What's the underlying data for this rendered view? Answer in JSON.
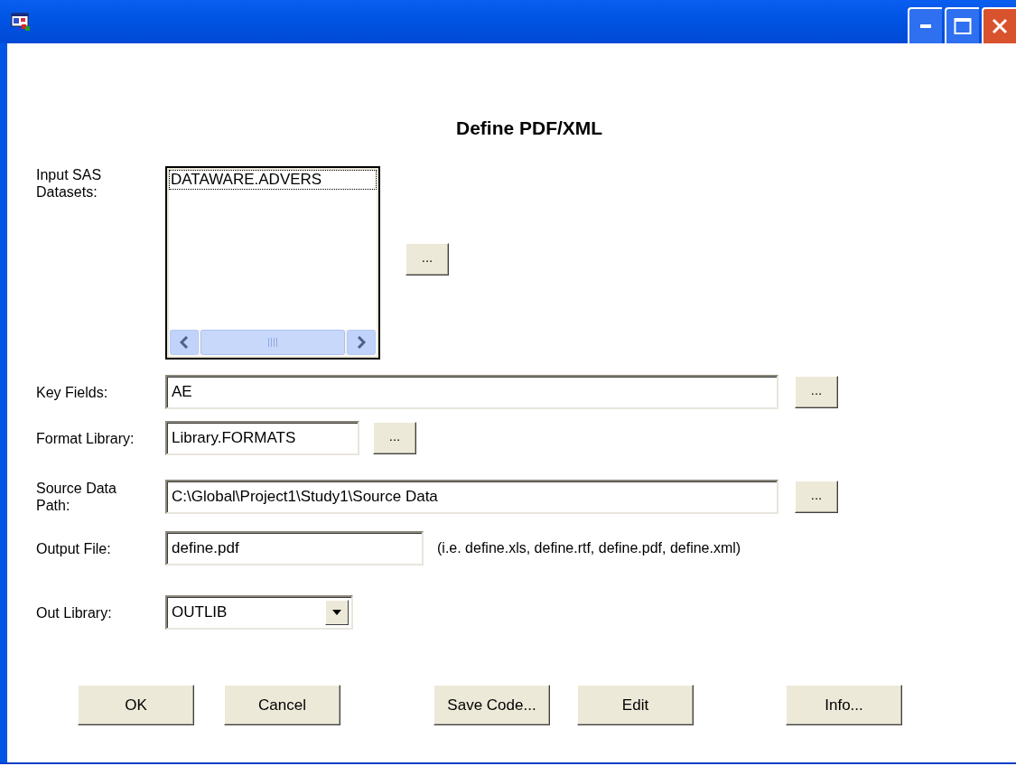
{
  "heading": "Define PDF/XML",
  "fields": [
    {
      "kind": "listbox",
      "label": "Input SAS Datasets:",
      "items": [
        {
          "label": "DATAWARE.ADVERS",
          "focused": true
        }
      ],
      "browse": "..."
    },
    {
      "kind": "text",
      "label": "Key Fields:",
      "value": "AE",
      "browse": "..."
    },
    {
      "kind": "text",
      "label": "Format Library:",
      "value": "Library.FORMATS",
      "browse": "..."
    },
    {
      "kind": "text",
      "label": "Source Data Path:",
      "value": "C:\\Global\\Project1\\Study1\\Source Data",
      "browse": "..."
    },
    {
      "kind": "text",
      "label": "Output File:",
      "value": "define.pdf",
      "hint": "(i.e. define.xls, define.rtf, define.pdf, define.xml)"
    },
    {
      "kind": "combo",
      "label": "Out Library:",
      "value": "OUTLIB"
    }
  ],
  "buttons": [
    "OK",
    "Cancel",
    "Save Code...",
    "Edit",
    "Info..."
  ]
}
